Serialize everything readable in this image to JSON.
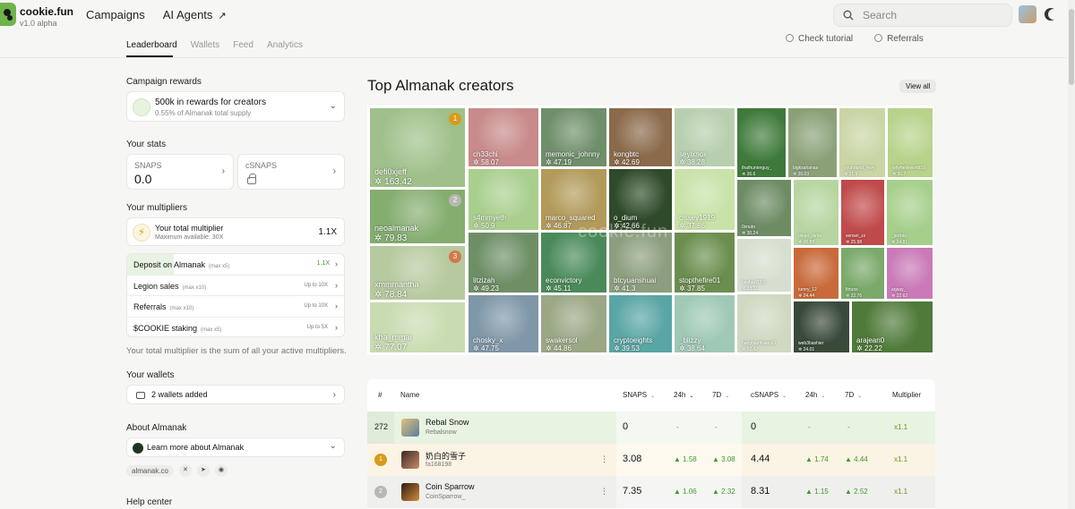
{
  "brand": {
    "name": "cookie.fun",
    "version": "v1.0 alpha"
  },
  "topnav": {
    "campaigns": "Campaigns",
    "ai_agents": "AI Agents",
    "arrow": "↗"
  },
  "search": {
    "placeholder": "Search"
  },
  "subtabs": [
    "Leaderboard",
    "Wallets",
    "Feed",
    "Analytics"
  ],
  "help_links": {
    "tutorial": "Check tutorial",
    "referrals": "Referrals"
  },
  "left": {
    "campaign_rewards_title": "Campaign rewards",
    "rewards_main": "500k in rewards for creators",
    "rewards_sub": "0.55% of Almanak total supply",
    "stats_title": "Your stats",
    "snaps_label": "SNAPS",
    "snaps_value": "0.0",
    "csnaps_label": "cSNAPS",
    "multipliers_title": "Your multipliers",
    "total_mult_label": "Your total multiplier",
    "total_mult_sub": "Maximum available: 30X",
    "total_mult_value": "1.1X",
    "mult_rows": [
      {
        "label": "Deposit on Almanak",
        "max": "(max x5)",
        "value": "1.1X"
      },
      {
        "label": "Legion sales",
        "max": "(max x10)",
        "value": "Up to 10X"
      },
      {
        "label": "Referrals",
        "max": "(max x10)",
        "value": "Up to 10X"
      },
      {
        "label": "$COOKIE staking",
        "max": "(max x5)",
        "value": "Up to 5X"
      }
    ],
    "mult_note": "Your total multiplier is the sum of all your active multipliers.",
    "wallets_title": "Your wallets",
    "wallets_value": "2 wallets added",
    "about_title": "About Almanak",
    "learn_more": "Learn more about Almanak",
    "site_link": "almanak.co",
    "help_title": "Help center"
  },
  "main": {
    "title": "Top Almanak creators",
    "view_all": "View all",
    "watermark": "cookie.fun",
    "colors": {
      "gold": "#d89b19",
      "silver": "#b7b7b3",
      "bronze": "#d07a4c",
      "green": "#3d9a2d",
      "mult": "#7a8c1a"
    },
    "tiles": [
      {
        "name": "defi0xjeff",
        "score": "163.42",
        "rank": "1"
      },
      {
        "name": "ch33chi",
        "score": "58.07"
      },
      {
        "name": "memonic_johnny",
        "score": "47.19"
      },
      {
        "name": "kongbtc",
        "score": "42.69"
      },
      {
        "name": "seylxnox",
        "score": "38.28"
      },
      {
        "name": "thathunterguy_",
        "score": "36.6"
      },
      {
        "name": "bigksahanas",
        "score": "35.03"
      },
      {
        "name": "youhound_livvy",
        "score": "31.9"
      },
      {
        "name": "whyhelloworld18",
        "score": "30.7"
      },
      {
        "name": "neoalmanak",
        "score": "79.83",
        "rank": "2"
      },
      {
        "name": "s4mmyeth",
        "score": "50.9"
      },
      {
        "name": "marco_squared",
        "score": "46.87"
      },
      {
        "name": "o_dium",
        "score": "42.66"
      },
      {
        "name": "cissey1919",
        "score": "37.86"
      },
      {
        "name": "0xnuto",
        "score": "30.24"
      },
      {
        "name": "diego_defai",
        "score": "26.88"
      },
      {
        "name": "sensei_zz",
        "score": "25.98"
      },
      {
        "name": "_jerrbky",
        "score": "24.81"
      },
      {
        "name": "xmmmantha",
        "score": "78.84",
        "rank": "3"
      },
      {
        "name": "litzizah",
        "score": "49.23"
      },
      {
        "name": "econvictory",
        "score": "45.11"
      },
      {
        "name": "btcyuanshuai",
        "score": "41.3"
      },
      {
        "name": "stopthefire01",
        "score": "37.85"
      },
      {
        "name": "bashar2003",
        "score": "28.31"
      },
      {
        "name": "tumry_12",
        "score": "24.44"
      },
      {
        "name": "firtuns",
        "score": "22.76"
      },
      {
        "name": "arjaay_",
        "score": "22.62"
      },
      {
        "name": "kha_mmai",
        "score": "77.07"
      },
      {
        "name": "chosky_x",
        "score": "47.75"
      },
      {
        "name": "swakersol",
        "score": "44.86"
      },
      {
        "name": "cryptoeights",
        "score": "39.53"
      },
      {
        "name": "_blizzy",
        "score": "38.64"
      },
      {
        "name": "hammedfinance1",
        "score": "27.42"
      },
      {
        "name": "web3bashier",
        "score": "24.01"
      },
      {
        "name": "arajean0",
        "score": "22.22"
      }
    ]
  },
  "table": {
    "headers": {
      "rank": "#",
      "name": "Name",
      "snaps": "SNAPS",
      "snaps_24h": "24h",
      "snaps_7d": "7D",
      "csnaps": "cSNAPS",
      "csnaps_24h": "24h",
      "csnaps_7d": "7D",
      "multiplier": "Multiplier"
    },
    "rows": [
      {
        "rank": "272",
        "name": "Rebal Snow",
        "handle": "Rebalsnow",
        "snaps": "0",
        "s24": "-",
        "s7": "-",
        "csnaps": "0",
        "c24": "-",
        "c7": "-",
        "mult": "x1.1"
      },
      {
        "rank": "1",
        "name": "奶白的雪子",
        "handle": "fa168198",
        "snaps": "3.08",
        "s24": "1.58",
        "s7": "3.08",
        "csnaps": "4.44",
        "c24": "1.74",
        "c7": "4.44",
        "mult": "x1.1"
      },
      {
        "rank": "2",
        "name": "Coin Sparrow",
        "handle": "CoinSparrow_",
        "snaps": "7.35",
        "s24": "1.06",
        "s7": "2.32",
        "csnaps": "8.31",
        "c24": "1.15",
        "c7": "2.52",
        "mult": "x1.1"
      }
    ]
  }
}
